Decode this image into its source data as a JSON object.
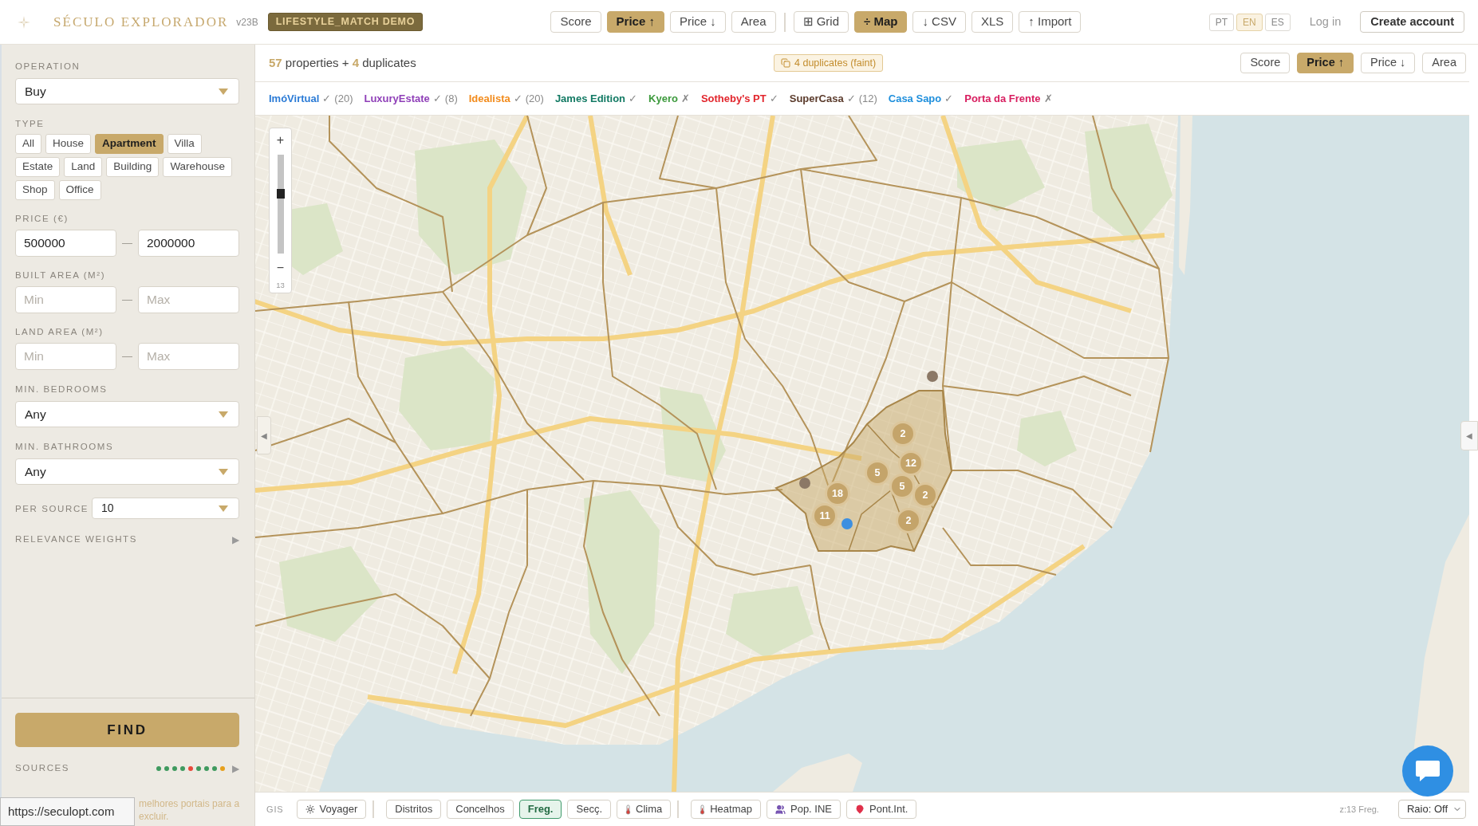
{
  "header": {
    "title": "SÉCULO EXPLORADOR",
    "version": "v23B",
    "badge": "LIFESTYLE_MATCH DEMO",
    "sort_buttons": [
      {
        "label": "Score",
        "selected": false
      },
      {
        "label": "Price ↑",
        "selected": true
      },
      {
        "label": "Price ↓",
        "selected": false
      },
      {
        "label": "Area",
        "selected": false
      }
    ],
    "view_buttons": [
      {
        "label": "⊞ Grid",
        "selected": false
      },
      {
        "label": "÷ Map",
        "selected": true
      }
    ],
    "export_buttons": [
      "↓ CSV",
      "XLS",
      "↑ Import"
    ],
    "languages": [
      {
        "label": "PT",
        "selected": false
      },
      {
        "label": "EN",
        "selected": true
      },
      {
        "label": "ES",
        "selected": false
      }
    ],
    "login": "Log in",
    "create_account": "Create account"
  },
  "sidebar": {
    "operation": {
      "label": "OPERATION",
      "value": "Buy"
    },
    "type": {
      "label": "TYPE",
      "options": [
        {
          "label": "All",
          "selected": false
        },
        {
          "label": "House",
          "selected": false
        },
        {
          "label": "Apartment",
          "selected": true
        },
        {
          "label": "Villa",
          "selected": false
        },
        {
          "label": "Estate",
          "selected": false
        },
        {
          "label": "Land",
          "selected": false
        },
        {
          "label": "Building",
          "selected": false
        },
        {
          "label": "Warehouse",
          "selected": false
        },
        {
          "label": "Shop",
          "selected": false
        },
        {
          "label": "Office",
          "selected": false
        }
      ]
    },
    "price": {
      "label": "PRICE (€)",
      "min": {
        "value": "500000"
      },
      "separator": "—",
      "max": {
        "value": "2000000"
      }
    },
    "built_area": {
      "label": "BUILT AREA (M²)",
      "min": {
        "placeholder": "Min"
      },
      "separator": "—",
      "max": {
        "placeholder": "Max"
      }
    },
    "land_area": {
      "label": "LAND AREA (M²)",
      "min": {
        "placeholder": "Min"
      },
      "separator": "—",
      "max": {
        "placeholder": "Max"
      }
    },
    "bedrooms": {
      "label": "MIN. BEDROOMS",
      "value": "Any"
    },
    "bathrooms": {
      "label": "MIN. BATHROOMS",
      "value": "Any"
    },
    "per_source": {
      "label": "PER SOURCE",
      "value": "10"
    },
    "relevance_weights": {
      "label": "RELEVANCE WEIGHTS",
      "arrow": "▶"
    },
    "find_button": "FIND",
    "sources": {
      "label": "SOURCES",
      "dots": [
        {
          "color": "#3f9a5f"
        },
        {
          "color": "#3f9a5f"
        },
        {
          "color": "#3f9a5f"
        },
        {
          "color": "#3f9a5f"
        },
        {
          "color": "#e8493b"
        },
        {
          "color": "#3f9a5f"
        },
        {
          "color": "#3f9a5f"
        },
        {
          "color": "#3f9a5f"
        },
        {
          "color": "#e6a01c"
        }
      ],
      "arrow": "▶"
    },
    "note": [
      "melhores portais para a",
      "excluir."
    ]
  },
  "results": {
    "summary": "**57** properties + **4** duplicates",
    "duplicates_badge": "4 duplicates (faint)",
    "sort_buttons": [
      {
        "label": "Score",
        "selected": false
      },
      {
        "label": "Price ↑",
        "selected": true
      },
      {
        "label": "Price ↓",
        "selected": false
      },
      {
        "label": "Area",
        "selected": false
      }
    ]
  },
  "sources": [
    {
      "name": "ImóVirtual",
      "color": "#2b7bd6",
      "mark": "✓",
      "count": "(20)"
    },
    {
      "name": "LuxuryEstate",
      "color": "#8f3fb8",
      "mark": "✓",
      "count": "(8)"
    },
    {
      "name": "Idealista",
      "color": "#f28b1c",
      "mark": "✓",
      "count": "(20)"
    },
    {
      "name": "James Edition",
      "color": "#137a64",
      "mark": "✓"
    },
    {
      "name": "Kyero",
      "color": "#3d9a3d",
      "mark": "✗"
    },
    {
      "name": "Sotheby's PT",
      "color": "#e2262d",
      "mark": "✓"
    },
    {
      "name": "SuperCasa",
      "color": "#5b3b2c",
      "mark": "✓",
      "count": "(12)"
    },
    {
      "name": "Casa Sapo",
      "color": "#1f8fdc",
      "mark": "✓"
    },
    {
      "name": "Porta da Frente",
      "color": "#d81d5f",
      "mark": "✗"
    }
  ],
  "map": {
    "zoom_in": "+",
    "zoom_out": "−",
    "zoom_level": "13",
    "zoom_slider": {
      "level": 0.62
    },
    "collapse_left": "◀",
    "collapse_right": "◀",
    "clusters": [
      {
        "count": "2"
      },
      {
        "count": "12"
      },
      {
        "count": "5"
      },
      {
        "count": "5"
      },
      {
        "count": "2"
      },
      {
        "count": "18"
      },
      {
        "count": "11"
      },
      {
        "count": "2"
      }
    ],
    "points": [
      {
        "color": "#8b7866"
      },
      {
        "color": "#8b7866"
      },
      {
        "color": "#3d8fe0"
      }
    ]
  },
  "gis_bar": {
    "label": "GIS",
    "groups": [
      [
        {
          "label": "Voyager",
          "selected": false
        }
      ],
      [
        {
          "label": "Distritos",
          "selected": false
        },
        {
          "label": "Concelhos",
          "selected": false
        },
        {
          "label": "Freg.",
          "selected": true
        },
        {
          "label": "Secç.",
          "selected": false
        },
        {
          "label": "Clima",
          "selected": false
        }
      ],
      [
        {
          "label": "Heatmap",
          "selected": false
        },
        {
          "label": "Pop. INE",
          "selected": false
        },
        {
          "label": "Pont.Int.",
          "selected": false
        }
      ]
    ],
    "zoom_info": "z:13 Freg.",
    "radius_select": "Raio: Off"
  },
  "browser_status_url": "https://seculopt.com"
}
